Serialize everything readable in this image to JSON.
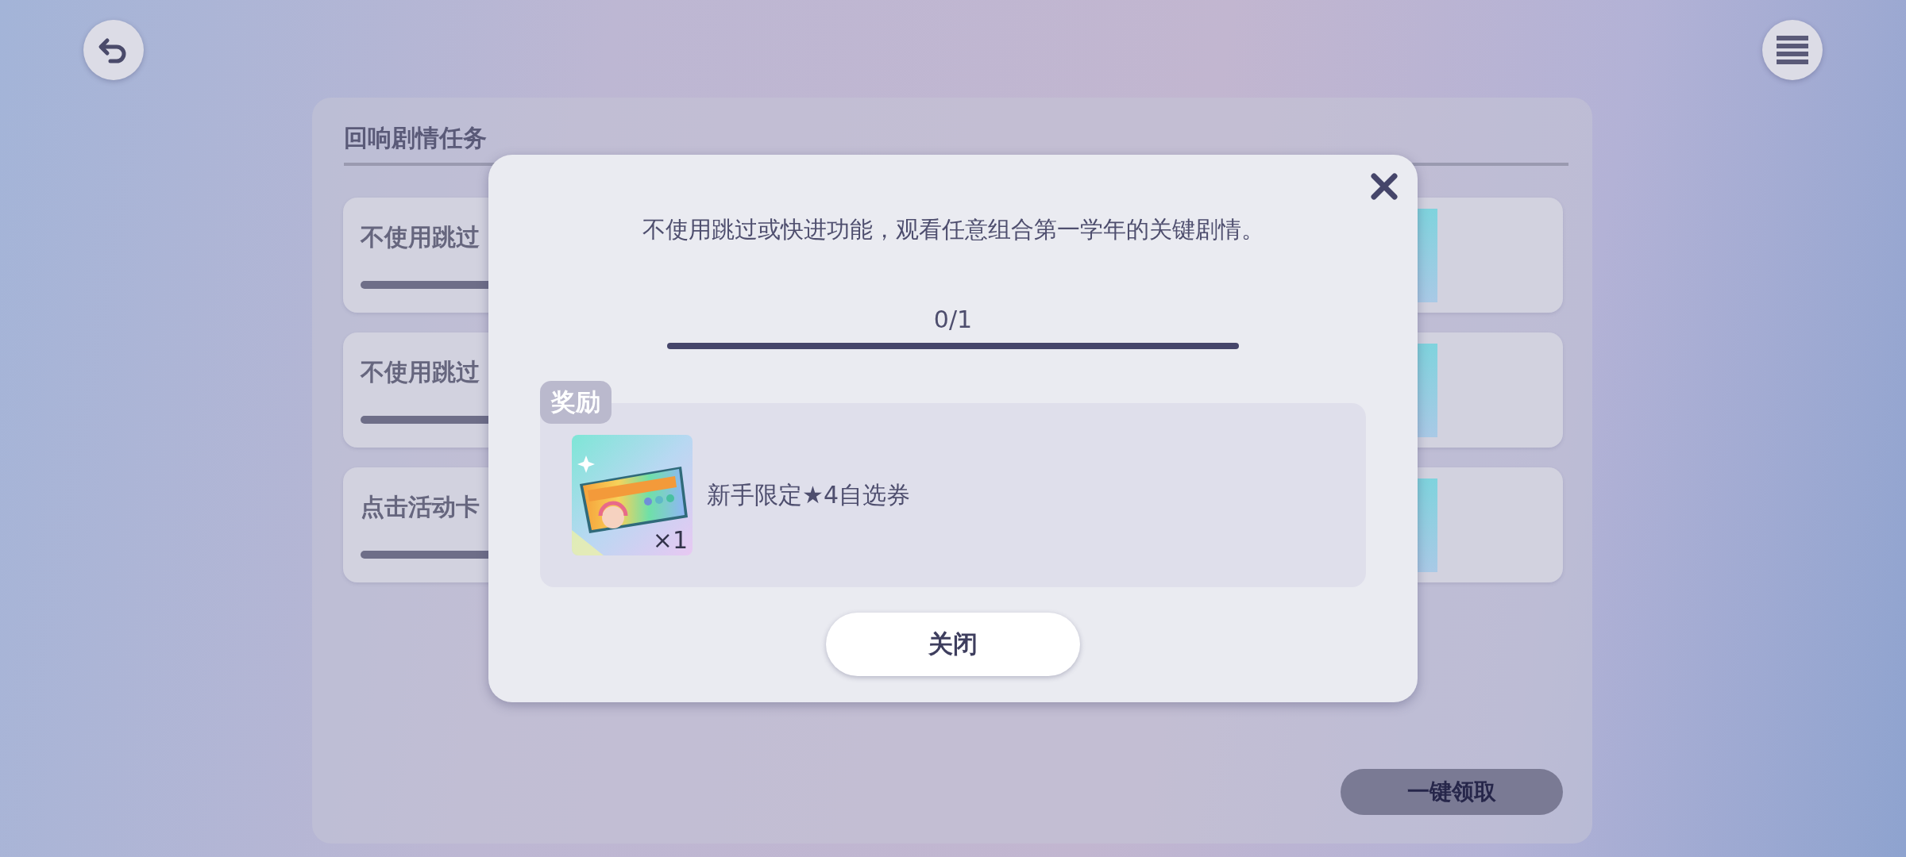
{
  "background": {
    "panel_title": "回响剧情任务",
    "missions": [
      {
        "title": "不使用跳过"
      },
      {
        "title": "不使用跳过"
      },
      {
        "title": "点击活动卡"
      }
    ],
    "claim_all_button": "一键领取"
  },
  "dialog": {
    "description": "不使用跳过或快进功能，观看任意组合第一学年的关键剧情。",
    "progress": {
      "reading": "0/1"
    },
    "reward_label": "奖励",
    "rewards": [
      {
        "kind": "picture",
        "name": "新手限定★4自选券",
        "quantity": "×1"
      }
    ],
    "close_button": "关闭"
  }
}
